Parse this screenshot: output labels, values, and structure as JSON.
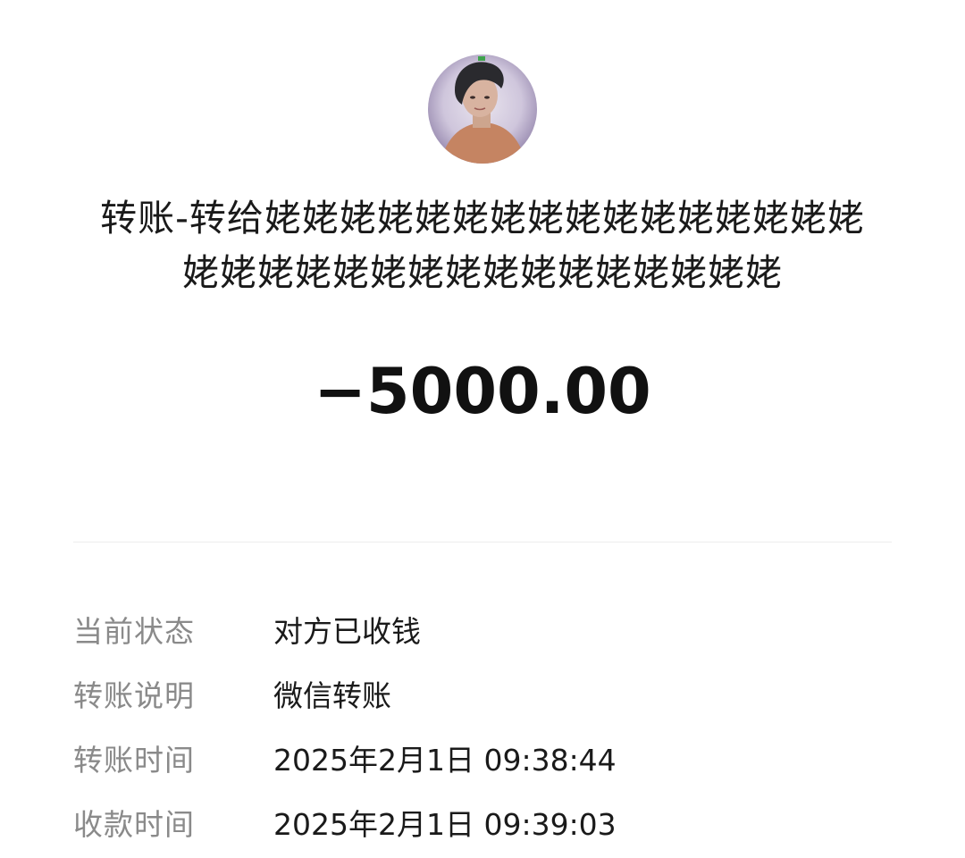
{
  "transfer": {
    "title_line1": "转账-转给姥姥姥姥姥姥姥姥姥姥姥姥姥姥姥姥",
    "title_line2": "姥姥姥姥姥姥姥姥姥姥姥姥姥姥姥姥",
    "amount": "−5000.00"
  },
  "details": [
    {
      "label": "当前状态",
      "value": "对方已收钱"
    },
    {
      "label": "转账说明",
      "value": "微信转账"
    },
    {
      "label": "转账时间",
      "value": "2025年2月1日 09:38:44"
    },
    {
      "label": "收款时间",
      "value": "2025年2月1日 09:39:03"
    }
  ],
  "colors": {
    "text": "#1a1a1a",
    "label": "#8a8a8a",
    "divider": "#ededed",
    "background": "#ffffff"
  },
  "icons": {
    "avatar": "user-avatar-photo"
  }
}
